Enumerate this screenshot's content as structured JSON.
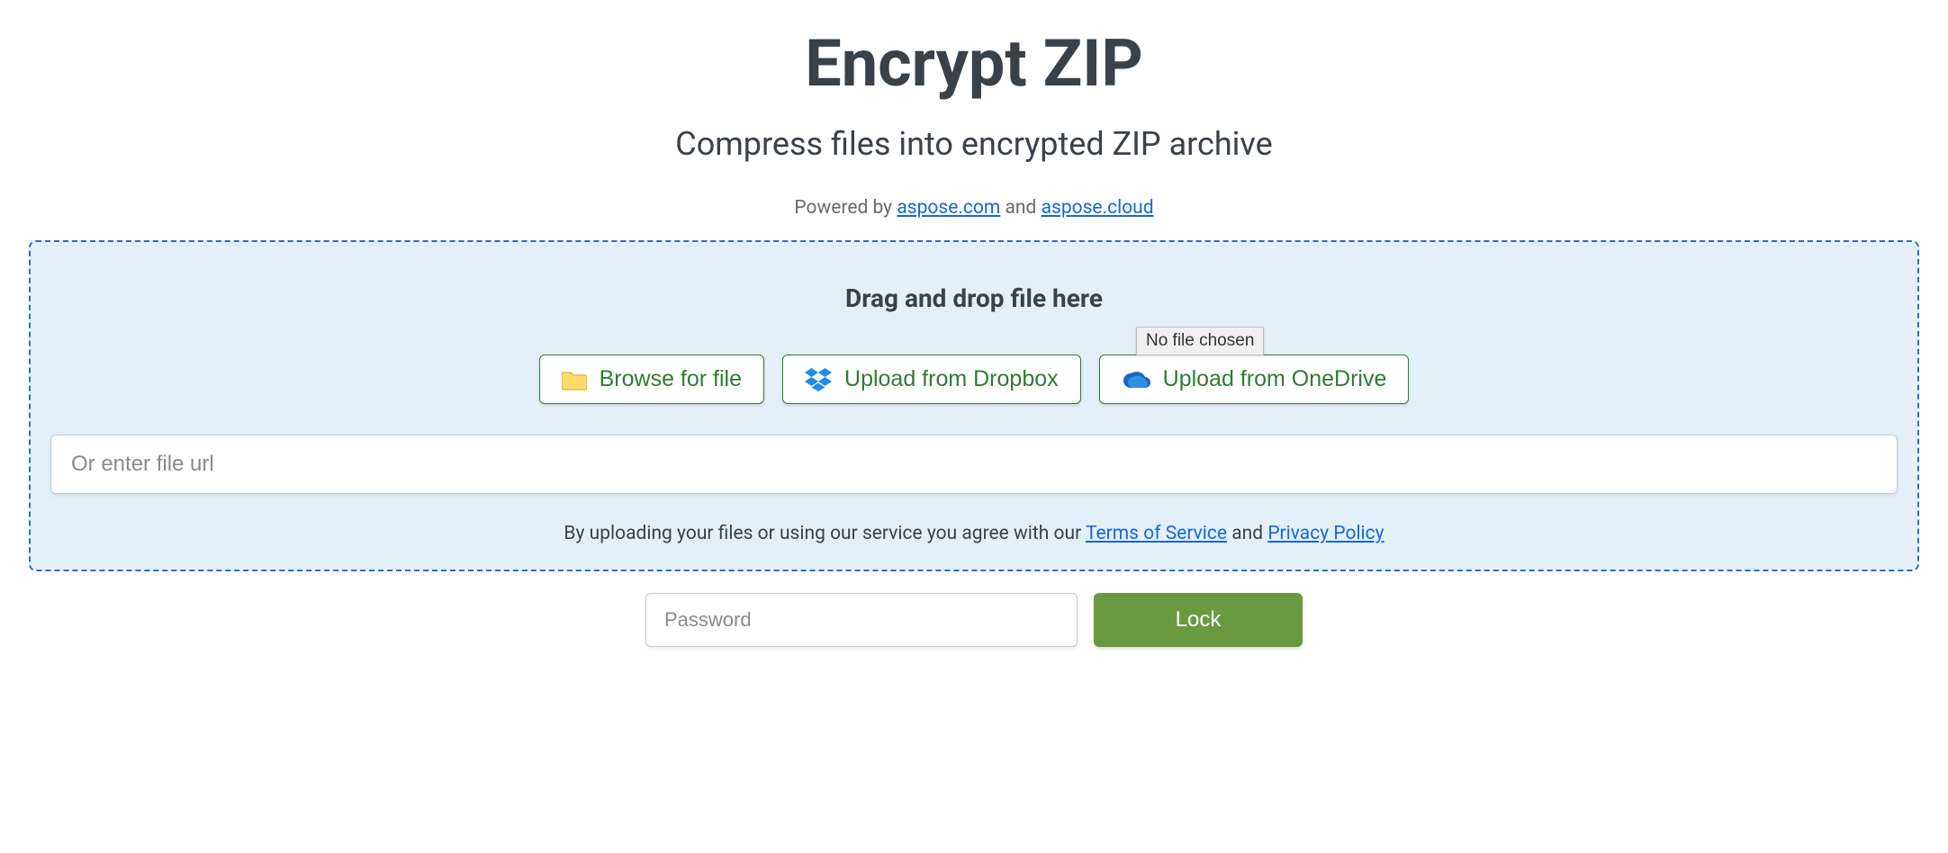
{
  "header": {
    "title": "Encrypt ZIP",
    "subtitle": "Compress files into encrypted ZIP archive",
    "powered_prefix": "Powered by ",
    "powered_link1": "aspose.com",
    "powered_mid": " and ",
    "powered_link2": "aspose.cloud"
  },
  "dropzone": {
    "title": "Drag and drop file here",
    "browse_label": "Browse for file",
    "dropbox_label": "Upload from Dropbox",
    "onedrive_label": "Upload from OneDrive",
    "tooltip": "No file chosen",
    "url_placeholder": "Or enter file url",
    "agree_prefix": "By uploading your files or using our service you agree with our ",
    "tos_label": "Terms of Service",
    "agree_mid": " and ",
    "privacy_label": "Privacy Policy"
  },
  "bottom": {
    "password_placeholder": "Password",
    "lock_label": "Lock"
  }
}
